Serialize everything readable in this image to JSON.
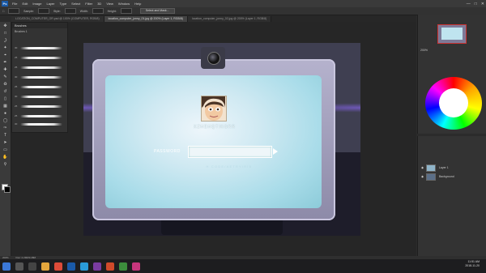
{
  "menubar": {
    "app_icon": "Ps",
    "items": [
      "File",
      "Edit",
      "Image",
      "Layer",
      "Type",
      "Select",
      "Filter",
      "3D",
      "View",
      "Window",
      "Help"
    ]
  },
  "optionsbar": {
    "labels": [
      "Sample:",
      "Style:",
      "Width:",
      "Height:"
    ],
    "button": "Select and Mask..."
  },
  "tabs": [
    "LOCATION_COMPUTER_OR.psd @ 100% (COMPUTER, RGB/8)",
    "location_computer_jonny_01.jpg @ 200% (Layer 1, RGB/8)",
    "location_computer_jonny_02.jpg @ 200% (Layer 1, RGB/8)"
  ],
  "brush_panel": {
    "title": "Brushes",
    "folder": "Brushes 1",
    "sizes": [
      "30",
      "25",
      "25",
      "30",
      "25",
      "30",
      "25",
      "25",
      "30"
    ]
  },
  "login": {
    "username": "XZHEHQTIKGRR",
    "password_label": "PASSWORD",
    "password_value": "",
    "hint": "H.CODE/AETRYIRIB"
  },
  "right_panels": {
    "navigator_zoom": "200%",
    "layers": [
      {
        "name": "Layer 1"
      },
      {
        "name": "Background"
      }
    ]
  },
  "statusbar": {
    "zoom": "200%",
    "doc": "Doc: 2.29M/3.28M"
  },
  "clock": {
    "time": "11:51 AM",
    "date": "2018-11-20"
  },
  "colors": {
    "screen": "#bfe4ef",
    "monitor": "#a8a5c3",
    "ps_blue": "#1a5aa8"
  }
}
